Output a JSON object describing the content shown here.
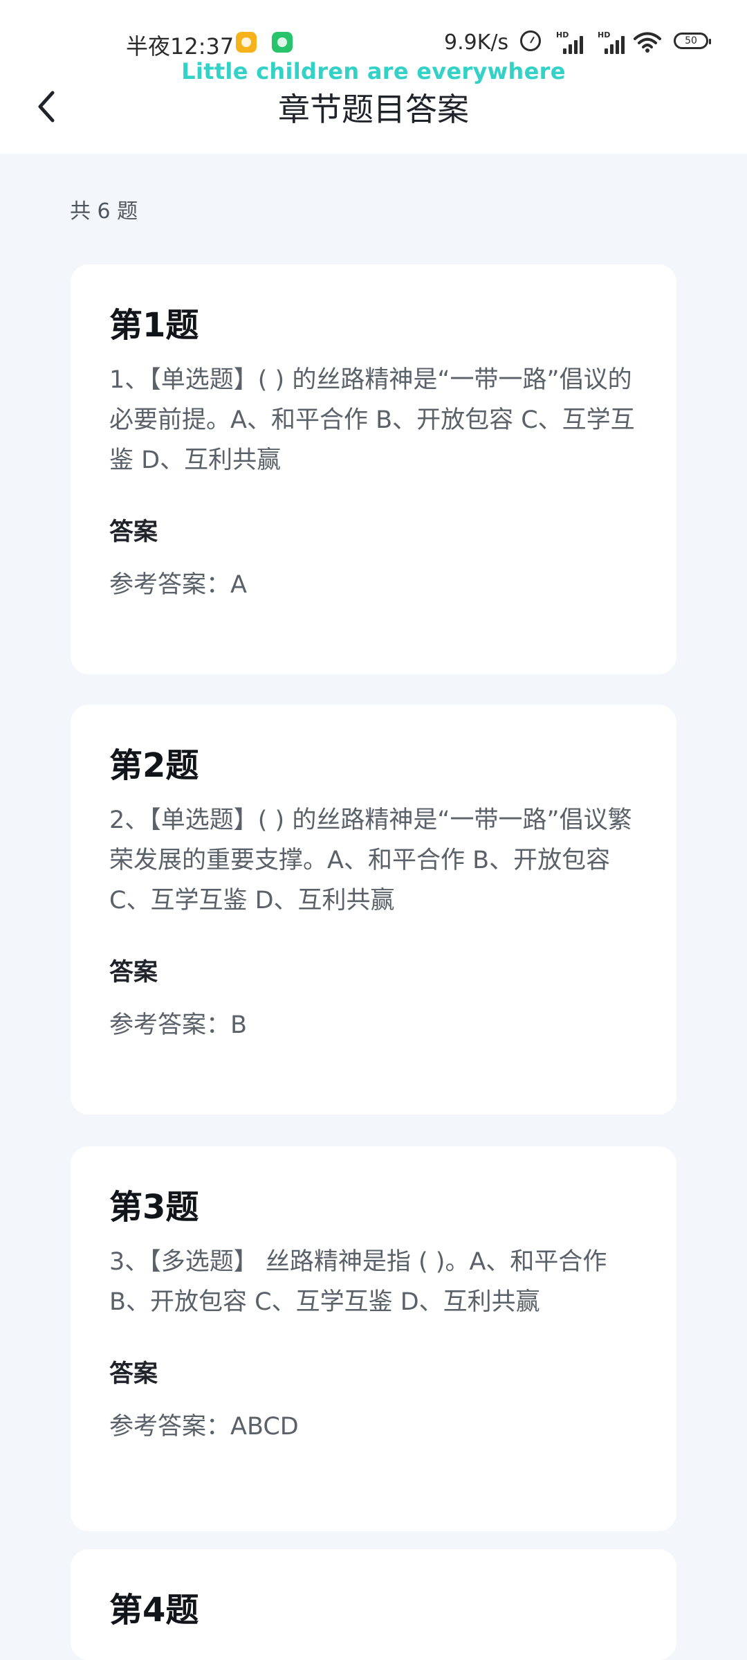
{
  "status_bar": {
    "time": "半夜12:37",
    "net_speed": "9.9K/s",
    "battery_level": "50",
    "icons": [
      "app-badge-icon",
      "app-badge-icon",
      "alarm-icon",
      "signal-hd-icon",
      "signal-hd-icon",
      "wifi-icon",
      "battery-icon"
    ]
  },
  "overlay": {
    "text": "Little children are everywhere"
  },
  "header": {
    "title": "章节题目答案",
    "back_icon": "chevron-left-icon"
  },
  "summary": {
    "count_label": "共 6 题"
  },
  "questions": [
    {
      "title": "第1题",
      "text": "1、【单选题】( ) 的丝路精神是“一带一路”倡议的必要前提。A、和平合作 B、开放包容 C、互学互鉴 D、互利共赢",
      "answer_heading": "答案",
      "answer": "参考答案：A"
    },
    {
      "title": "第2题",
      "text": "2、【单选题】( ) 的丝路精神是“一带一路”倡议繁荣发展的重要支撑。A、和平合作 B、开放包容 C、互学互鉴 D、互利共赢",
      "answer_heading": "答案",
      "answer": "参考答案：B"
    },
    {
      "title": "第3题",
      "text": "3、【多选题】 丝路精神是指 ( )。A、和平合作 B、开放包容 C、互学互鉴 D、互利共赢",
      "answer_heading": "答案",
      "answer": "参考答案：ABCD"
    },
    {
      "title": "第4题"
    }
  ]
}
